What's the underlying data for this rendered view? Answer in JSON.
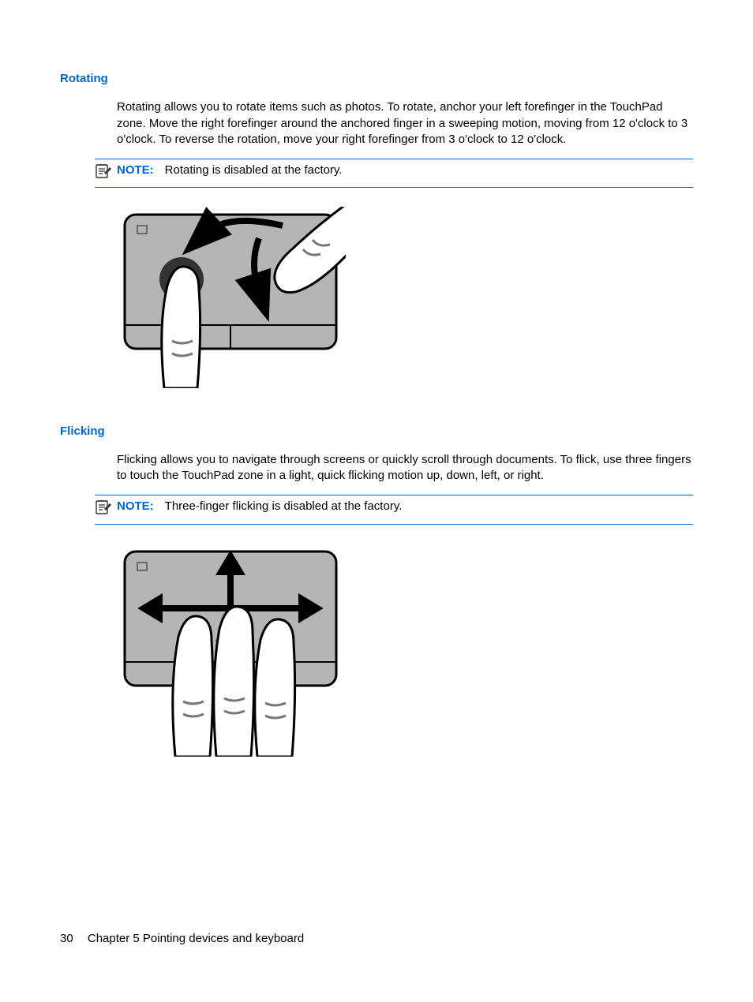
{
  "sections": {
    "rotating": {
      "heading": "Rotating",
      "body": "Rotating allows you to rotate items such as photos. To rotate, anchor your left forefinger in the TouchPad zone. Move the right forefinger around the anchored finger in a sweeping motion, moving from 12 o'clock to 3 o'clock. To reverse the rotation, move your right forefinger from 3 o'clock to 12 o'clock.",
      "note_label": "NOTE:",
      "note_text": "Rotating is disabled at the factory."
    },
    "flicking": {
      "heading": "Flicking",
      "body": "Flicking allows you to navigate through screens or quickly scroll through documents. To flick, use three fingers to touch the TouchPad zone in a light, quick flicking motion up, down, left, or right.",
      "note_label": "NOTE:",
      "note_text": "Three-finger flicking is disabled at the factory."
    }
  },
  "footer": {
    "page_number": "30",
    "chapter": "Chapter 5   Pointing devices and keyboard"
  }
}
